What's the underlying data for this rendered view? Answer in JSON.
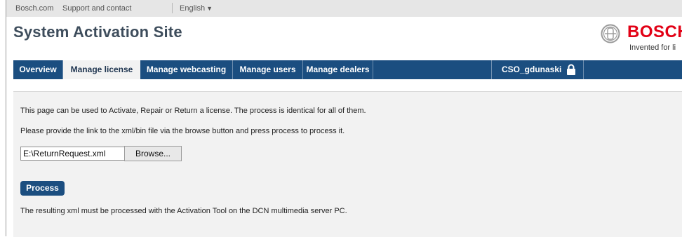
{
  "topbar": {
    "links": [
      "Bosch.com",
      "Support and contact"
    ],
    "language": "English"
  },
  "header": {
    "title": "System Activation Site",
    "brand_name": "BOSCH",
    "brand_tagline": "Invented for li"
  },
  "nav": {
    "tabs": [
      {
        "label": "Overview",
        "active": false
      },
      {
        "label": "Manage license",
        "active": true
      },
      {
        "label": "Manage webcasting",
        "active": false
      },
      {
        "label": "Manage users",
        "active": false
      },
      {
        "label": "Manage dealers",
        "active": false
      }
    ],
    "user": "CSO_gdunaski",
    "user_icon": "lock-icon"
  },
  "content": {
    "intro": "This page can be used to Activate, Repair or Return a license. The process is identical for all of them.",
    "instructions": "Please provide the link to the xml/bin file via the browse button and press process to process it.",
    "file_value": "E:\\ReturnRequest.xml",
    "browse_label": "Browse...",
    "process_label": "Process",
    "result_note": "The resulting xml must be processed with the Activation Tool on the DCN multimedia server PC."
  },
  "colors": {
    "nav_bg": "#1b4e80",
    "brand_red": "#e20015",
    "title": "#3e4d5c",
    "content_bg": "#f2f2f2"
  }
}
